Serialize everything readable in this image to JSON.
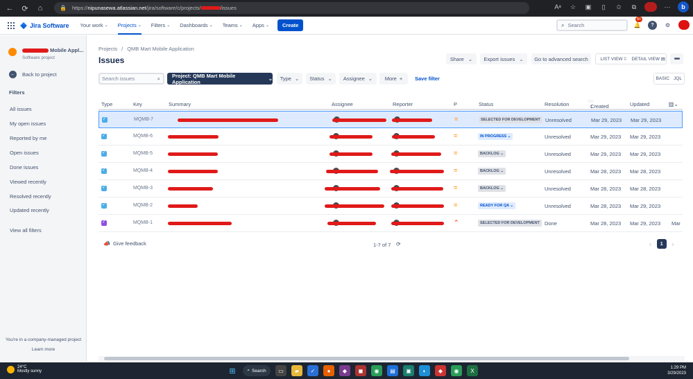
{
  "browser": {
    "url_prefix": "https://",
    "url_host": "nipunasewa.atlassian.net",
    "url_path": "/jira/software/c/projects/",
    "url_suffix": "/issues"
  },
  "topnav": {
    "app_name": "Jira Software",
    "items": [
      "Your work",
      "Projects",
      "Filters",
      "Dashboards",
      "Teams",
      "Apps"
    ],
    "create_label": "Create",
    "search_placeholder": "Search",
    "notification_badge": "9+"
  },
  "sidebar": {
    "project_name_suffix": "Mobile Appl...",
    "project_type": "Software project",
    "back_label": "Back to project",
    "filters_heading": "Filters",
    "filter_items": [
      "All issues",
      "My open issues",
      "Reported by me",
      "Open issues",
      "Done issues",
      "Viewed recently",
      "Resolved recently",
      "Updated recently"
    ],
    "view_all": "View all filters",
    "footer_text": "You're in a company-managed project",
    "learn_more": "Learn more"
  },
  "main": {
    "breadcrumb": [
      "Projects",
      "/",
      "QMB Mart Mobile Application"
    ],
    "title": "Issues",
    "share_label": "Share",
    "export_label": "Export issues",
    "advanced_search_label": "Go to advanced search",
    "list_view_label": "LIST VIEW",
    "detail_view_label": "DETAIL VIEW",
    "search_placeholder": "Search issues",
    "project_filter": "Project: QMB Mart Mobile Application",
    "type_filter": "Type",
    "status_filter": "Status",
    "assignee_filter": "Assignee",
    "more_filter": "More",
    "save_filter": "Save filter",
    "basic_label": "BASIC",
    "jql_label": "JQL"
  },
  "table": {
    "headers": [
      "Type",
      "Key",
      "Summary",
      "Assignee",
      "Reporter",
      "P",
      "Status",
      "Resolution",
      "Created",
      "Updated"
    ],
    "rows": [
      {
        "key": "MQMB-7",
        "status": "SELECTED FOR DEVELOPMENT",
        "resolution": "Unresolved",
        "created": "Mar 29, 2023",
        "updated": "Mar 29, 2023",
        "extra": ""
      },
      {
        "key": "MQMB-6",
        "status": "IN PROGRESS",
        "resolution": "Unresolved",
        "created": "Mar 29, 2023",
        "updated": "Mar 29, 2023",
        "extra": ""
      },
      {
        "key": "MQMB-5",
        "status": "BACKLOG",
        "resolution": "Unresolved",
        "created": "Mar 29, 2023",
        "updated": "Mar 29, 2023",
        "extra": ""
      },
      {
        "key": "MQMB-4",
        "status": "BACKLOG",
        "resolution": "Unresolved",
        "created": "Mar 28, 2023",
        "updated": "Mar 28, 2023",
        "extra": ""
      },
      {
        "key": "MQMB-3",
        "status": "BACKLOG",
        "resolution": "Unresolved",
        "created": "Mar 28, 2023",
        "updated": "Mar 28, 2023",
        "extra": ""
      },
      {
        "key": "MQMB-2",
        "status": "READY FOR QA",
        "resolution": "Unresolved",
        "created": "Mar 28, 2023",
        "updated": "Mar 29, 2023",
        "extra": ""
      },
      {
        "key": "MQMB-1",
        "status": "SELECTED FOR DEVELOPMENT",
        "resolution": "Done",
        "created": "Mar 28, 2023",
        "updated": "Mar 29, 2023",
        "extra": "Mar"
      }
    ]
  },
  "footer": {
    "feedback": "Give feedback",
    "count": "1-7 of 7",
    "current_page": "1"
  },
  "taskbar": {
    "temp": "24°C",
    "weather": "Mostly sunny",
    "search": "Search",
    "time": "1:29 PM",
    "date": "3/29/2023"
  },
  "colors": {
    "accent": "#0052cc",
    "dark_button": "#253858",
    "redaction": "#e01a1a",
    "selected_row": "#deebff"
  }
}
